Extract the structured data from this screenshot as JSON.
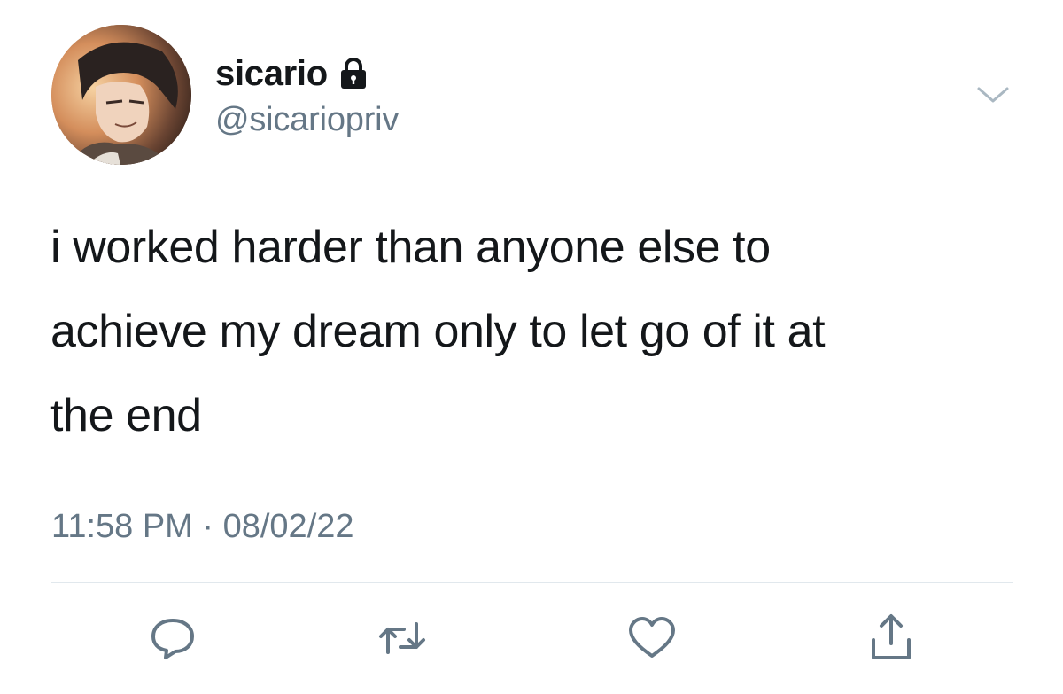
{
  "user": {
    "display_name": "sicario",
    "handle": "@sicariopriv",
    "protected_icon": "lock-icon",
    "avatar_icon": "avatar"
  },
  "tweet": {
    "line1": "i worked harder than anyone else to",
    "line2": "achieve my dream only to let go of it at",
    "line3": "the end",
    "timestamp": "11:58 PM · 08/02/22"
  },
  "actions": {
    "reply_icon": "reply-icon",
    "retweet_icon": "retweet-icon",
    "like_icon": "heart-icon",
    "share_icon": "share-icon"
  },
  "colors": {
    "text": "#14171a",
    "secondary": "#657786",
    "divider": "#e1e8ed"
  }
}
